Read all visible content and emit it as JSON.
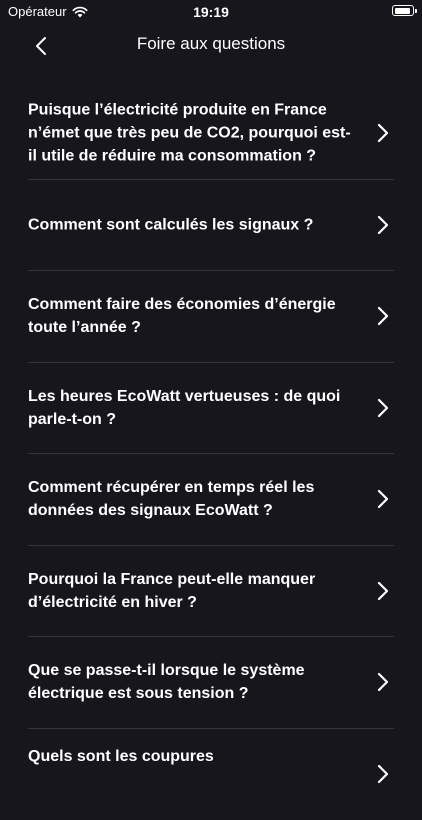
{
  "status_bar": {
    "carrier": "Opérateur",
    "time": "19:19"
  },
  "nav": {
    "title": "Foire aux questions"
  },
  "faq": {
    "items": [
      "Puisque l’électricité produite en France n’émet que très peu de CO2, pourquoi est-il utile de réduire ma consommation ?",
      "Comment sont calculés les signaux ?",
      "Comment faire des économies d’énergie toute l’année ?",
      "Les heures EcoWatt vertueuses : de quoi parle-t-on ?",
      "Comment récupérer en temps réel les données des signaux EcoWatt ?",
      "Pourquoi la France peut-elle manquer d’électricité en hiver ?",
      "Que se passe-t-il lorsque le système électrique est sous tension ?",
      "Quels sont les coupures"
    ]
  },
  "colors": {
    "background": "#16161c",
    "text": "#ffffff",
    "divider": "#34343c"
  }
}
